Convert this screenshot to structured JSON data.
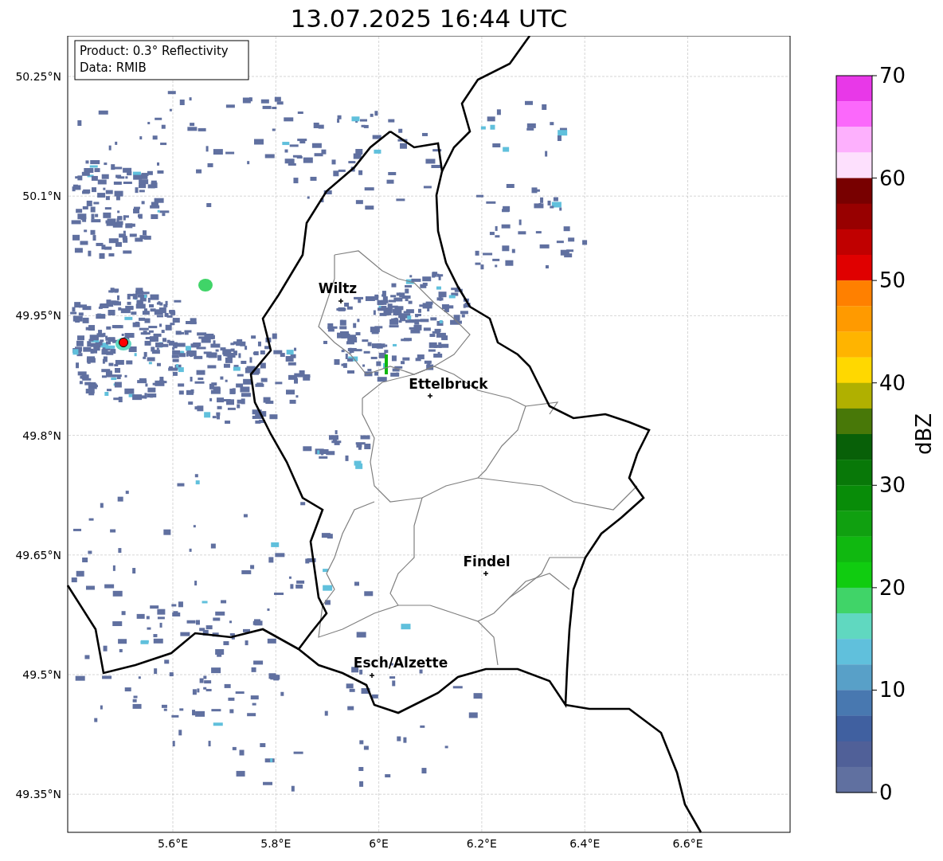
{
  "title": "13.07.2025 16:44 UTC",
  "info_box": [
    "Product: 0.3° Reflectivity",
    "Data: RMIB"
  ],
  "map": {
    "lat_ticks": [
      "50.25°N",
      "50.1°N",
      "49.95°N",
      "49.8°N",
      "49.65°N",
      "49.5°N",
      "49.35°N"
    ],
    "lon_ticks": [
      "5.6°E",
      "5.8°E",
      "6°E",
      "6.2°E",
      "6.4°E",
      "6.6°E"
    ],
    "cities": [
      {
        "name": "Wiltz"
      },
      {
        "name": "Ettelbruck"
      },
      {
        "name": "Findel"
      },
      {
        "name": "Esch/Alzette"
      }
    ]
  },
  "colorbar": {
    "label": "dBZ",
    "ticks": [
      "70",
      "60",
      "50",
      "40",
      "30",
      "20",
      "10",
      "0"
    ],
    "bins": [
      {
        "color": "#e838e8"
      },
      {
        "color": "#fb68fb"
      },
      {
        "color": "#fdb0fd"
      },
      {
        "color": "#fde0fd"
      },
      {
        "color": "#780000"
      },
      {
        "color": "#980000"
      },
      {
        "color": "#c00000"
      },
      {
        "color": "#e00000"
      },
      {
        "color": "#ff8000"
      },
      {
        "color": "#ff9a00"
      },
      {
        "color": "#ffb400"
      },
      {
        "color": "#ffd800"
      },
      {
        "color": "#b0b000"
      },
      {
        "color": "#487808"
      },
      {
        "color": "#086008"
      },
      {
        "color": "#087808"
      },
      {
        "color": "#088c08"
      },
      {
        "color": "#10a010"
      },
      {
        "color": "#10b810"
      },
      {
        "color": "#10cc10"
      },
      {
        "color": "#40d468"
      },
      {
        "color": "#60d8c0"
      },
      {
        "color": "#60c0dc"
      },
      {
        "color": "#58a0c8"
      },
      {
        "color": "#4878b0"
      },
      {
        "color": "#4060a0"
      },
      {
        "color": "#506098"
      },
      {
        "color": "#6070a0"
      }
    ]
  }
}
